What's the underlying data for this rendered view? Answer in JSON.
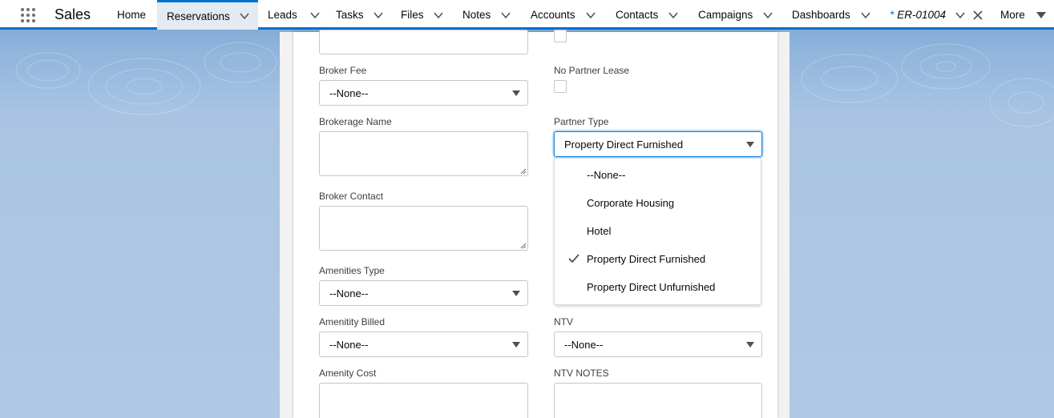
{
  "app": {
    "name": "Sales"
  },
  "nav": {
    "home": "Home",
    "reservations": "Reservations",
    "leads": "Leads",
    "tasks": "Tasks",
    "files": "Files",
    "notes": "Notes",
    "accounts": "Accounts",
    "contacts": "Contacts",
    "campaigns": "Campaigns",
    "dashboards": "Dashboards",
    "record_tab_marker": "*",
    "record_tab": "ER-01004",
    "more": "More"
  },
  "colors": {
    "accent": "#0070d2",
    "active_tab_bg": "#e4eaf2"
  },
  "form": {
    "broker_fee": {
      "label": "Broker Fee",
      "value": "--None--"
    },
    "no_partner_lease": {
      "label": "No Partner Lease",
      "checked": false
    },
    "brokerage_name": {
      "label": "Brokerage Name",
      "value": ""
    },
    "partner_type": {
      "label": "Partner Type",
      "value": "Property Direct Furnished",
      "options": [
        "--None--",
        "Corporate Housing",
        "Hotel",
        "Property Direct Furnished",
        "Property Direct Unfurnished"
      ],
      "selected_index": 3
    },
    "broker_contact": {
      "label": "Broker Contact",
      "value": ""
    },
    "amenities_type": {
      "label": "Amenities Type",
      "value": "--None--"
    },
    "amenitity_billed": {
      "label": "Amenitity Billed",
      "value": "--None--"
    },
    "ntv": {
      "label": "NTV",
      "value": "--None--"
    },
    "amenity_cost": {
      "label": "Amenity Cost",
      "value": ""
    },
    "ntv_notes": {
      "label": "NTV NOTES",
      "value": ""
    }
  }
}
